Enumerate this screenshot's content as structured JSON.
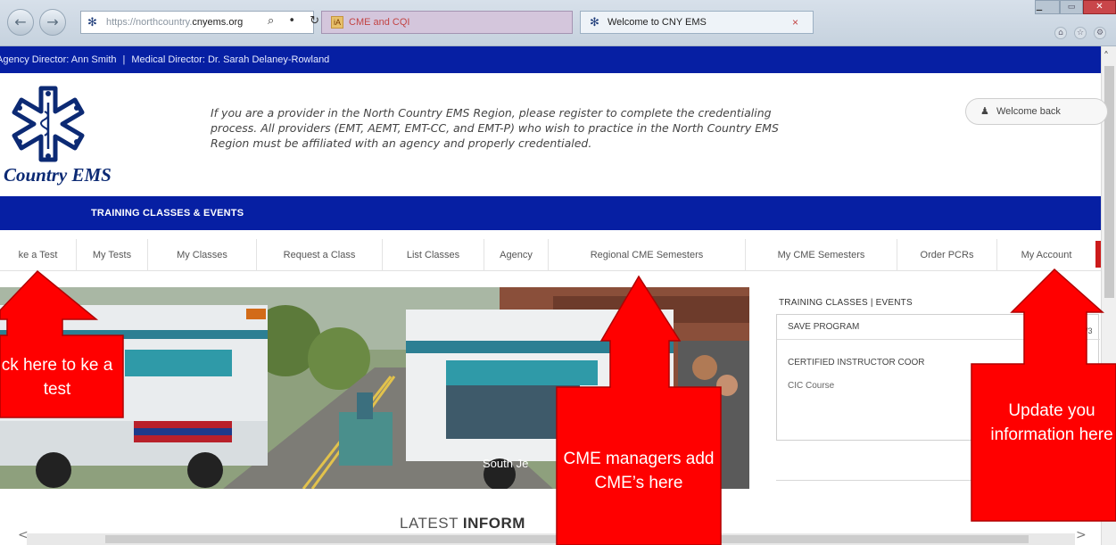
{
  "browser": {
    "url_prefix": "https://northcountry.",
    "url_domain": "cnyems.org",
    "url_controls": "⌕ • ↻",
    "tabs": [
      {
        "label": "CME and CQI",
        "active": false
      },
      {
        "label": "Welcome to CNY EMS",
        "active": true,
        "close": "×"
      }
    ],
    "window_controls": {
      "minimize": "–",
      "maximize": "▭",
      "close": "✕"
    }
  },
  "director_bar": {
    "agency_director": "Agency Director: Ann Smith",
    "separator": "|",
    "medical_director": "Medical Director: Dr. Sarah Delaney-Rowland"
  },
  "header": {
    "logo_text": "Country EMS",
    "intro_text": "If you are a provider in the North Country EMS Region, please register to complete the credentialing process. All providers (EMT, AEMT, EMT-CC, and EMT-P) who wish to practice in the North Country EMS Region must be affiliated with an agency and properly credentialed.",
    "welcome_button": "Welcome back"
  },
  "blue_nav": {
    "item": "TRAINING CLASSES & EVENTS"
  },
  "menu": [
    "ke a Test",
    "My Tests",
    "My Classes",
    "Request a Class",
    "List Classes",
    "Agency",
    "Regional CME Semesters",
    "My CME Semesters",
    "Order PCRs",
    "My Account"
  ],
  "banner": {
    "caption": "South Je"
  },
  "training_panel": {
    "heading": "TRAINING CLASSES | EVENTS",
    "items": [
      {
        "title": "SAVE PROGRAM",
        "subtitle": ""
      },
      {
        "title": "CERTIFIED INSTRUCTOR COOR",
        "subtitle": "CIC Course"
      }
    ],
    "page": "1/3"
  },
  "latest": {
    "prefix": "LATEST ",
    "bold": "INFORM"
  },
  "scroll": {
    "left": "<",
    "right": ">",
    "chevron": "ˇ"
  },
  "annotations": [
    {
      "text": "ck here to ke a test"
    },
    {
      "text": "CME managers add CME’s here"
    },
    {
      "text": "Update you information here"
    }
  ],
  "colors": {
    "nav_blue": "#061fa3",
    "annotation_red": "#ff0000",
    "accent_red": "#cc1b1b",
    "logo_navy": "#0c2a74"
  }
}
